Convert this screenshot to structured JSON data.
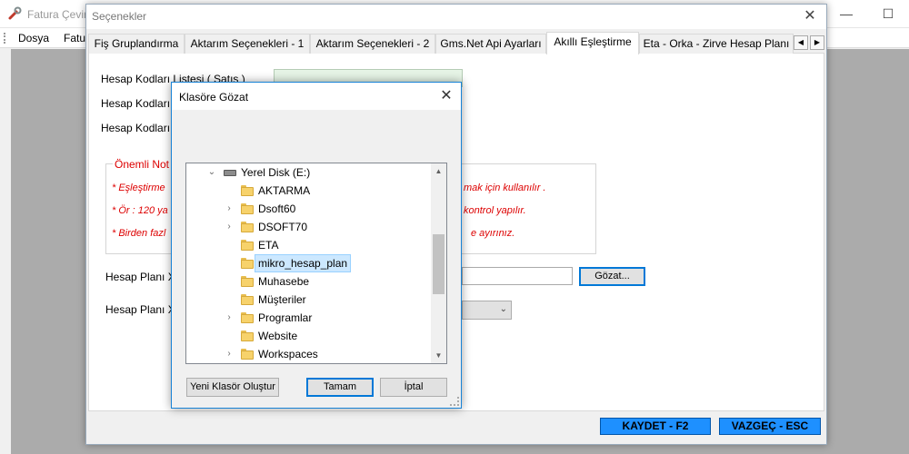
{
  "app": {
    "title": "Fatura Çevir",
    "menu": [
      "Dosya",
      "Fatu"
    ]
  },
  "settings": {
    "title": "Seçenekler",
    "tabs": [
      "Fiş Gruplandırma",
      "Aktarım Seçenekleri - 1",
      "Aktarım Seçenekleri - 2",
      "Gms.Net Api Ayarları",
      "Akıllı Eşleştirme",
      "Eta - Orka - Zirve Hesap Planı"
    ],
    "active_tab": "Akıllı Eşleştirme",
    "labels": {
      "hesap_kodlari_satis": "Hesap Kodları Listesi ( Satış )",
      "hesap_kodlari_2": "Hesap Kodları",
      "hesap_kodlari_3": "Hesap Kodları",
      "hesap_plani_1": "Hesap Planı X",
      "hesap_plani_2": "Hesap Planı X"
    },
    "note": {
      "title": "Önemli Not",
      "line1_start": "* Eşleştirme",
      "line1_end": "mak için kullanılır .",
      "line2_start": "* Ör : 120 ya",
      "line2_end": "kontrol yapılır.",
      "line3_start": "* Birden fazl",
      "line3_end": "e ayırınız."
    },
    "browse_button": "Gözat...",
    "save_button": "KAYDET - F2",
    "cancel_button": "VAZGEÇ - ESC"
  },
  "dialog": {
    "title": "Klasöre Gözat",
    "drive": "Yerel Disk (E:)",
    "folders": [
      {
        "name": "AKTARMA",
        "expandable": false,
        "selected": false
      },
      {
        "name": "Dsoft60",
        "expandable": true,
        "selected": false
      },
      {
        "name": "DSOFT70",
        "expandable": true,
        "selected": false
      },
      {
        "name": "ETA",
        "expandable": false,
        "selected": false
      },
      {
        "name": "mikro_hesap_plan",
        "expandable": false,
        "selected": true
      },
      {
        "name": "Muhasebe",
        "expandable": false,
        "selected": false
      },
      {
        "name": "Müşteriler",
        "expandable": false,
        "selected": false
      },
      {
        "name": "Programlar",
        "expandable": true,
        "selected": false
      },
      {
        "name": "Website",
        "expandable": false,
        "selected": false
      },
      {
        "name": "Workspaces",
        "expandable": true,
        "selected": false
      }
    ],
    "new_folder_button": "Yeni Klasör Oluştur",
    "ok_button": "Tamam",
    "cancel_button": "İptal"
  },
  "colors": {
    "selection": "#cce8ff",
    "note_text": "#dd0000",
    "action_button": "#1e90ff"
  }
}
